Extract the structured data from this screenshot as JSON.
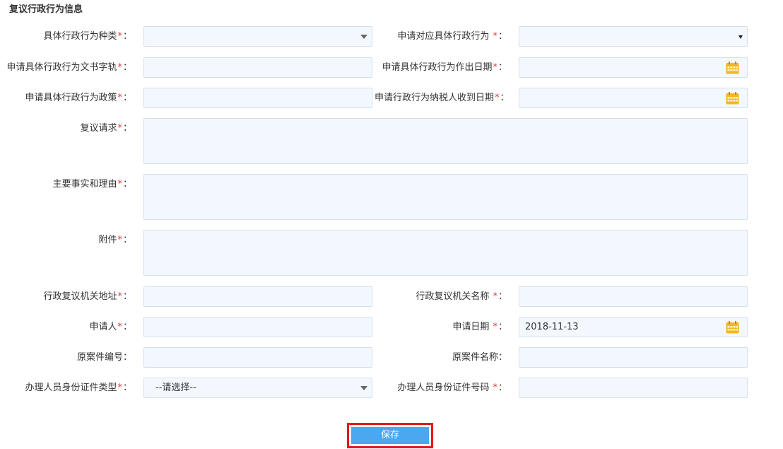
{
  "section": {
    "title": "复议行政行为信息"
  },
  "required_mark": "*",
  "colon": "：",
  "fields": {
    "action_type": {
      "label": "具体行政行为种类",
      "value": ""
    },
    "corresponding_action": {
      "label": "申请对应具体行政行为 ",
      "value": ""
    },
    "doc_number": {
      "label": "申请具体行政行为文书字轨",
      "value": ""
    },
    "action_date": {
      "label": "申请具体行政行为作出日期",
      "value": ""
    },
    "policy": {
      "label": "申请具体行政行为政策",
      "value": ""
    },
    "received_date": {
      "label": "申请行政行为纳税人收到日期",
      "value": ""
    },
    "request": {
      "label": "复议请求",
      "value": ""
    },
    "facts_reasons": {
      "label": "主要事实和理由",
      "value": ""
    },
    "attachment": {
      "label": "附件",
      "value": ""
    },
    "agency_address": {
      "label": "行政复议机关地址",
      "value": ""
    },
    "agency_name": {
      "label": "行政复议机关名称 ",
      "value": ""
    },
    "applicant": {
      "label": "申请人",
      "value": ""
    },
    "apply_date": {
      "label": "申请日期 ",
      "value": "2018-11-13"
    },
    "orig_case_no": {
      "label": "原案件编号",
      "value": ""
    },
    "orig_case_name": {
      "label": "原案件名称",
      "value": ""
    },
    "id_type": {
      "label": "办理人员身份证件类型",
      "value": "--请选择--"
    },
    "id_number": {
      "label": "办理人员身份证件号码 ",
      "value": ""
    }
  },
  "buttons": {
    "save": "保存"
  },
  "colors": {
    "required": "#e4393c",
    "field_bg": "#f3f8fe",
    "field_border": "#d4dfea",
    "button_bg": "#4aa7f0",
    "highlight_border": "#e8161c",
    "calendar_icon": "#f5b623"
  }
}
